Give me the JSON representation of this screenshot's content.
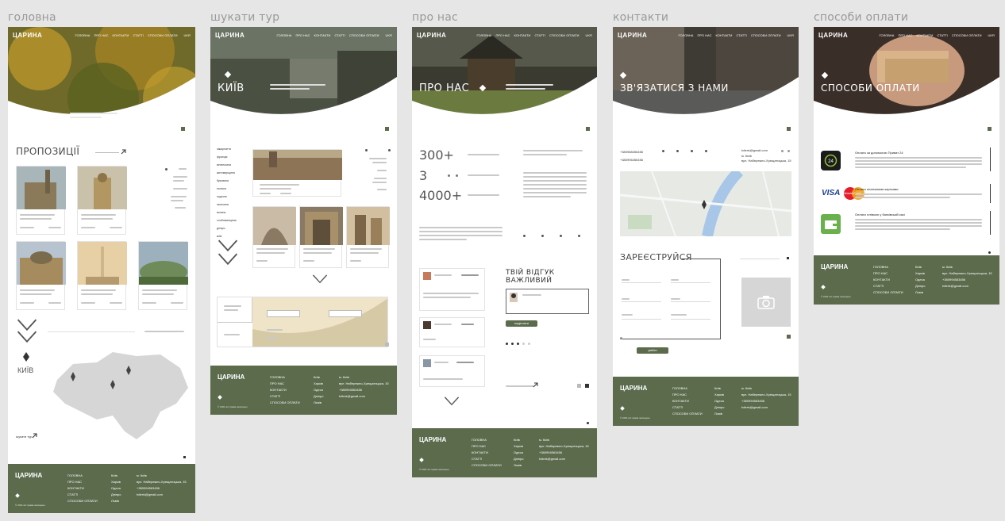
{
  "frames": [
    {
      "id": "home",
      "title": "головна"
    },
    {
      "id": "search",
      "title": "шукати тур"
    },
    {
      "id": "about",
      "title": "про нас"
    },
    {
      "id": "contacts",
      "title": "контакти"
    },
    {
      "id": "payment",
      "title": "способи оплати"
    }
  ],
  "logo": "ЦАРИНА",
  "nav": [
    "ГОЛОВНА",
    "ПРО НАС",
    "КОНТАКТИ",
    "СТАТТІ",
    "СПОСОБИ ОПЛАТИ"
  ],
  "lang": "UKR",
  "home": {
    "section_title": "ПРОПОЗИЦІЇ",
    "city_label": "КИЇВ",
    "tour_link": "шукати тур"
  },
  "search": {
    "hero_title": "КИЇВ",
    "sidebar": [
      "закарпаття",
      "франція",
      "вінниччина",
      "житомирщина",
      "буковина",
      "полісся",
      "поділля",
      "галичина",
      "волинь",
      "слобожанщина",
      "дніпро",
      "київ"
    ]
  },
  "about": {
    "hero_title": "ПРО НАС",
    "stats": [
      "300+",
      "3",
      "4000+"
    ],
    "review_title": "ТВІЙ ВІДГУК ВАЖЛИВИЙ",
    "send_label": "надіслати"
  },
  "contacts": {
    "hero_title": "ЗВ'ЯЗАТИСЯ З НАМИ",
    "phone1": "+380988456456",
    "phone2": "+380996456456",
    "email": "tvitrek@gmail.com",
    "register_title": "ЗАРЕЄСТРУЙСЯ",
    "register_btn": "увійти"
  },
  "payment": {
    "hero_title": "СПОСОБИ ОПЛАТИ",
    "methods": [
      {
        "title": "Оплата за допомогою Приват 24"
      },
      {
        "title": "Оплата платіжними картками"
      },
      {
        "title": "Оплата готівкою у банківській касі"
      }
    ],
    "visa": "VISA",
    "mastercard": "MasterCard"
  },
  "footer": {
    "col2": [
      "ГОЛОВНА",
      "ПРО НАС",
      "КОНТАКТИ",
      "СТАТТІ",
      "СПОСОБИ ОПЛАТИ"
    ],
    "col3": [
      "Київ",
      "Харків",
      "Одеса",
      "Дніпро",
      "Львів"
    ],
    "address_city": "м. Київ",
    "address": "вул. Набережно-Хрещатицька, 15",
    "phone": "+380994563456",
    "email": "tvitrek@gmail.com",
    "copy": "© 2021 всі права захищено"
  },
  "colors": {
    "brand": "#5b6b4c",
    "hero_dark": "#2e3a26",
    "board_bg": "#e6e6e6"
  }
}
